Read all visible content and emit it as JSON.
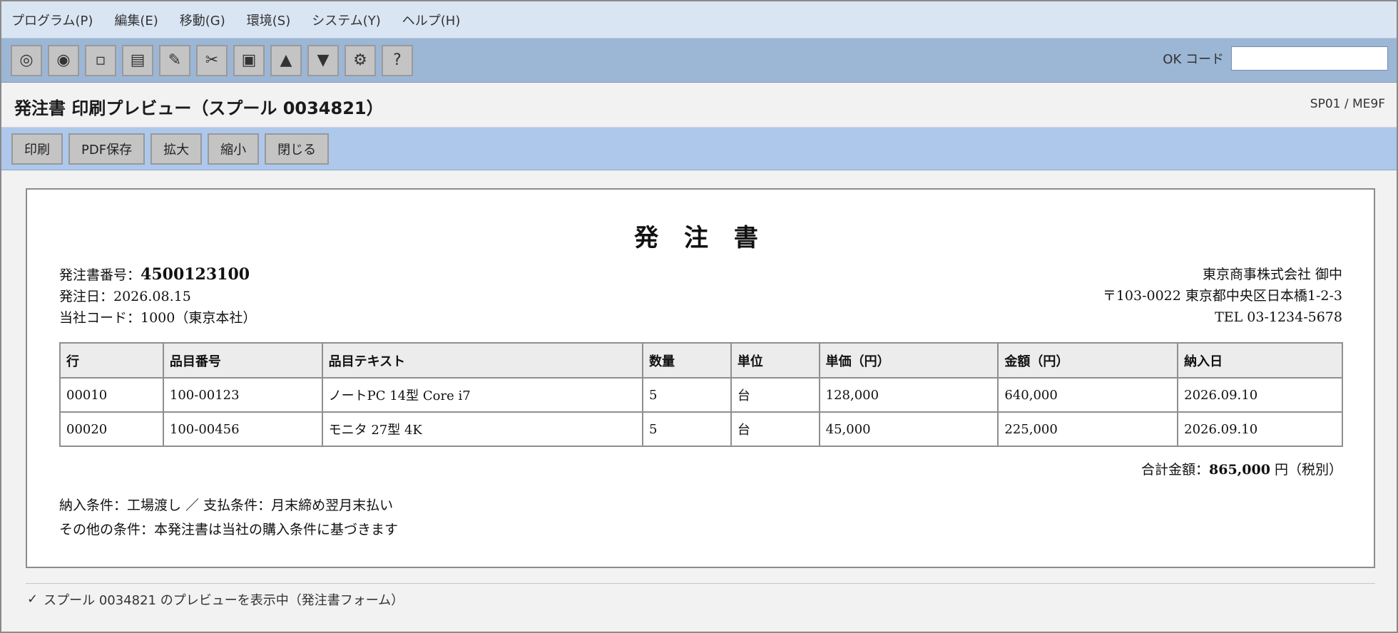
{
  "menu": [
    "プログラム(P)",
    "編集(E)",
    "移動(G)",
    "環境(S)",
    "システム(Y)",
    "ヘルプ(H)"
  ],
  "toolbar": {
    "icons": [
      "◎",
      "◉",
      "▫",
      "▤",
      "✎",
      "✂",
      "▣",
      "▲",
      "▼",
      "⚙",
      "?"
    ],
    "okcode_label": "OK コード",
    "okcode_value": ""
  },
  "title": {
    "text": "発注書 印刷プレビュー（スプール 0034821）",
    "system": "SP01 / ME9F"
  },
  "actions": [
    "印刷",
    "PDF保存",
    "拡大",
    "縮小",
    "閉じる"
  ],
  "document": {
    "title": "発 注 書",
    "po_label": "発注書番号：",
    "po_number": "4500123100",
    "order_date": "発注日：2026.08.15",
    "company_code": "当社コード：1000（東京本社）",
    "vendor_name": "東京商事株式会社 御中",
    "vendor_address": "〒103-0022 東京都中央区日本橋1-2-3",
    "vendor_tel": "TEL 03-1234-5678",
    "table": {
      "headers": [
        "行",
        "品目番号",
        "品目テキスト",
        "数量",
        "単位",
        "単価（円）",
        "金額（円）",
        "納入日"
      ],
      "rows": [
        [
          "00010",
          "100-00123",
          "ノートPC 14型 Core i7",
          "5",
          "台",
          "128,000",
          "640,000",
          "2026.09.10"
        ],
        [
          "00020",
          "100-00456",
          "モニタ 27型 4K",
          "5",
          "台",
          "45,000",
          "225,000",
          "2026.09.10"
        ]
      ]
    },
    "total_label": "合計金額：",
    "total_amount": "865,000",
    "total_suffix": " 円（税別）",
    "terms_1": "納入条件：工場渡し ／ 支払条件：月末締め翌月末払い",
    "terms_2": "その他の条件：本発注書は当社の購入条件に基づきます"
  },
  "status": {
    "icon": "✓",
    "text": "スプール 0034821 のプレビューを表示中（発注書フォーム）"
  }
}
